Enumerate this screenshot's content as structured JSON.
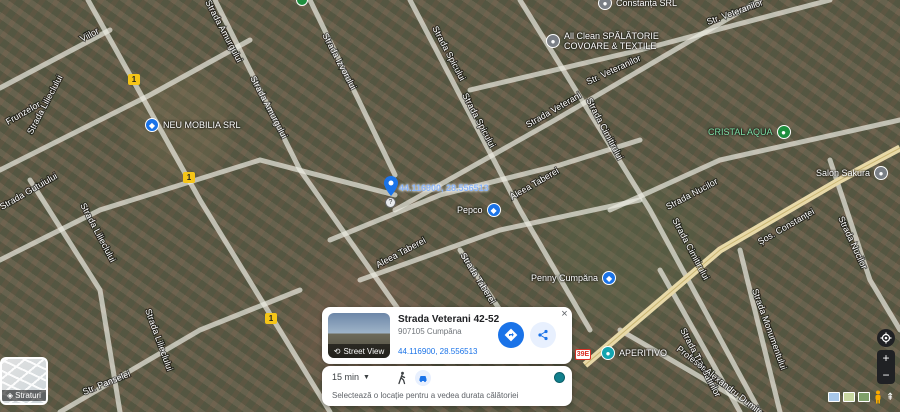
{
  "roads": [
    {
      "label": "Viilor"
    },
    {
      "label": "Frunzelor"
    },
    {
      "label": "Strada Amurgului"
    },
    {
      "label": "Strada Amurgului"
    },
    {
      "label": "Strada Izvorului"
    },
    {
      "label": "Strada Spicului"
    },
    {
      "label": "Strada Spicului"
    },
    {
      "label": "Strada Veterani"
    },
    {
      "label": "Str. Veteranilor"
    },
    {
      "label": "Str. Veteranilor"
    },
    {
      "label": "Strada Cimitirului"
    },
    {
      "label": "Strada Cimitirului"
    },
    {
      "label": "Strada Nucilor"
    },
    {
      "label": "Șos. Constanței"
    },
    {
      "label": "Strada Nucilor"
    },
    {
      "label": "Strada Lilieclului"
    },
    {
      "label": "Strada Lilieclului"
    },
    {
      "label": "Strada Lilieclului"
    },
    {
      "label": "Strada Gutuiului"
    },
    {
      "label": "Aleea Taberei"
    },
    {
      "label": "Aleea Taberei"
    },
    {
      "label": "Strada Taberei"
    },
    {
      "label": "Strada Trandafirilor"
    },
    {
      "label": "Strada Monumentului"
    },
    {
      "label": "Str. Panselei"
    },
    {
      "label": "Profesor Alexandru Dumitrescu"
    }
  ],
  "pois": {
    "constanta": "Constanța SRL",
    "allclean_line1": "All Clean SPĂLĂTORIE",
    "allclean_line2": "COVOARE & TEXTILE",
    "neu_mobilia": "NEU MOBILIA SRL",
    "cristal_aqua": "CRISTAL AQUA",
    "salon_sakura": "Salon Sakura",
    "pepco": "Pepco",
    "penny": "Penny Cumpăna",
    "aperitivo": "APERITIVO"
  },
  "route_badges": [
    "1",
    "1",
    "1"
  ],
  "road_badge": "39E",
  "dropped_pin": {
    "coords": "44.116900, 28.556513"
  },
  "layers": {
    "label": "Straturi"
  },
  "info_card": {
    "street_view_label": "Street View",
    "title": "Strada Veterani 42-52",
    "subtitle": "907105 Cumpăna",
    "coords": "44.116900, 28.556513",
    "close": "×"
  },
  "travel": {
    "time": "15 min",
    "hint": "Selectează o locație pentru a vedea durata călătoriei"
  },
  "controls": {
    "zoom_in": "+",
    "zoom_out": "−"
  },
  "colors": {
    "accent": "#1a73e8",
    "teal": "#12808d",
    "poi_green": "#1e8e3e",
    "major_road": "#e8d9a8"
  }
}
